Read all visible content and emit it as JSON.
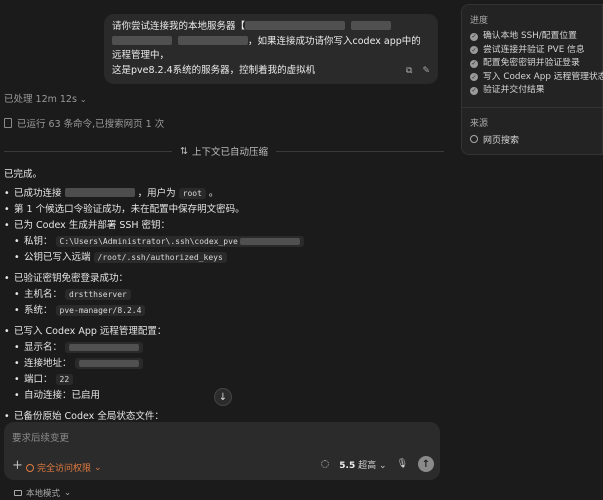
{
  "user_message": {
    "line1_prefix": "请你尝试连接我的本地服务器【",
    "line2_suffix": "，如果连接成功请你写入codex app中的远程管理中，",
    "line3": "这是pve8.2.4系统的服务器，控制着我的虚拟机"
  },
  "status": {
    "processed": "已处理 12m 12s",
    "ran": "已运行 63 条命令,已搜索网页 1 次",
    "compressed": "上下文已自动压缩"
  },
  "content": {
    "done": "已完成。",
    "conn_prefix": "已成功连接",
    "conn_mid": "，用户为",
    "conn_user": "root",
    "conn_end": "。",
    "first_pwd": "第 1 个候选口令验证成功，未在配置中保存明文密码。",
    "ssh_head": "已为 Codex 生成并部署 SSH 密钥：",
    "private_key_label": "私钥：",
    "private_key_path": "C:\\Users\\Administrator\\.ssh\\codex_pve",
    "public_key_label": "公钥已写入远端",
    "public_key_path": "/root/.ssh/authorized_keys",
    "verified_head": "已验证密钥免密登录成功：",
    "hostname_label": "主机名：",
    "hostname": "drstthserver",
    "system_label": "系统：",
    "system": "pve-manager/8.2.4",
    "remote_head": "已写入 Codex App 远程管理配置：",
    "display_label": "显示名：",
    "address_label": "连接地址：",
    "port_label": "端口：",
    "port": "22",
    "autoconnect": "自动连接：已启用",
    "backup": "已备份原始 Codex 全局状态文件："
  },
  "composer": {
    "placeholder": "要求后续变更",
    "access": "完全访问权限",
    "model": "5.5",
    "speed": "超高"
  },
  "bottom": {
    "mode": "本地模式"
  },
  "panel": {
    "progress_title": "进度",
    "steps": [
      "确认本地 SSH/配置位置",
      "尝试连接并验证 PVE 信息",
      "配置免密密钥并验证登录",
      "写入 Codex App 远程管理状态",
      "验证并交付结果"
    ],
    "sources_title": "来源",
    "source_item": "网页搜索"
  },
  "icons": {
    "copy": "copy-icon",
    "edit": "edit-icon",
    "compress": "compress-icon",
    "scroll": "arrow-down-icon",
    "send": "arrow-up-icon"
  }
}
